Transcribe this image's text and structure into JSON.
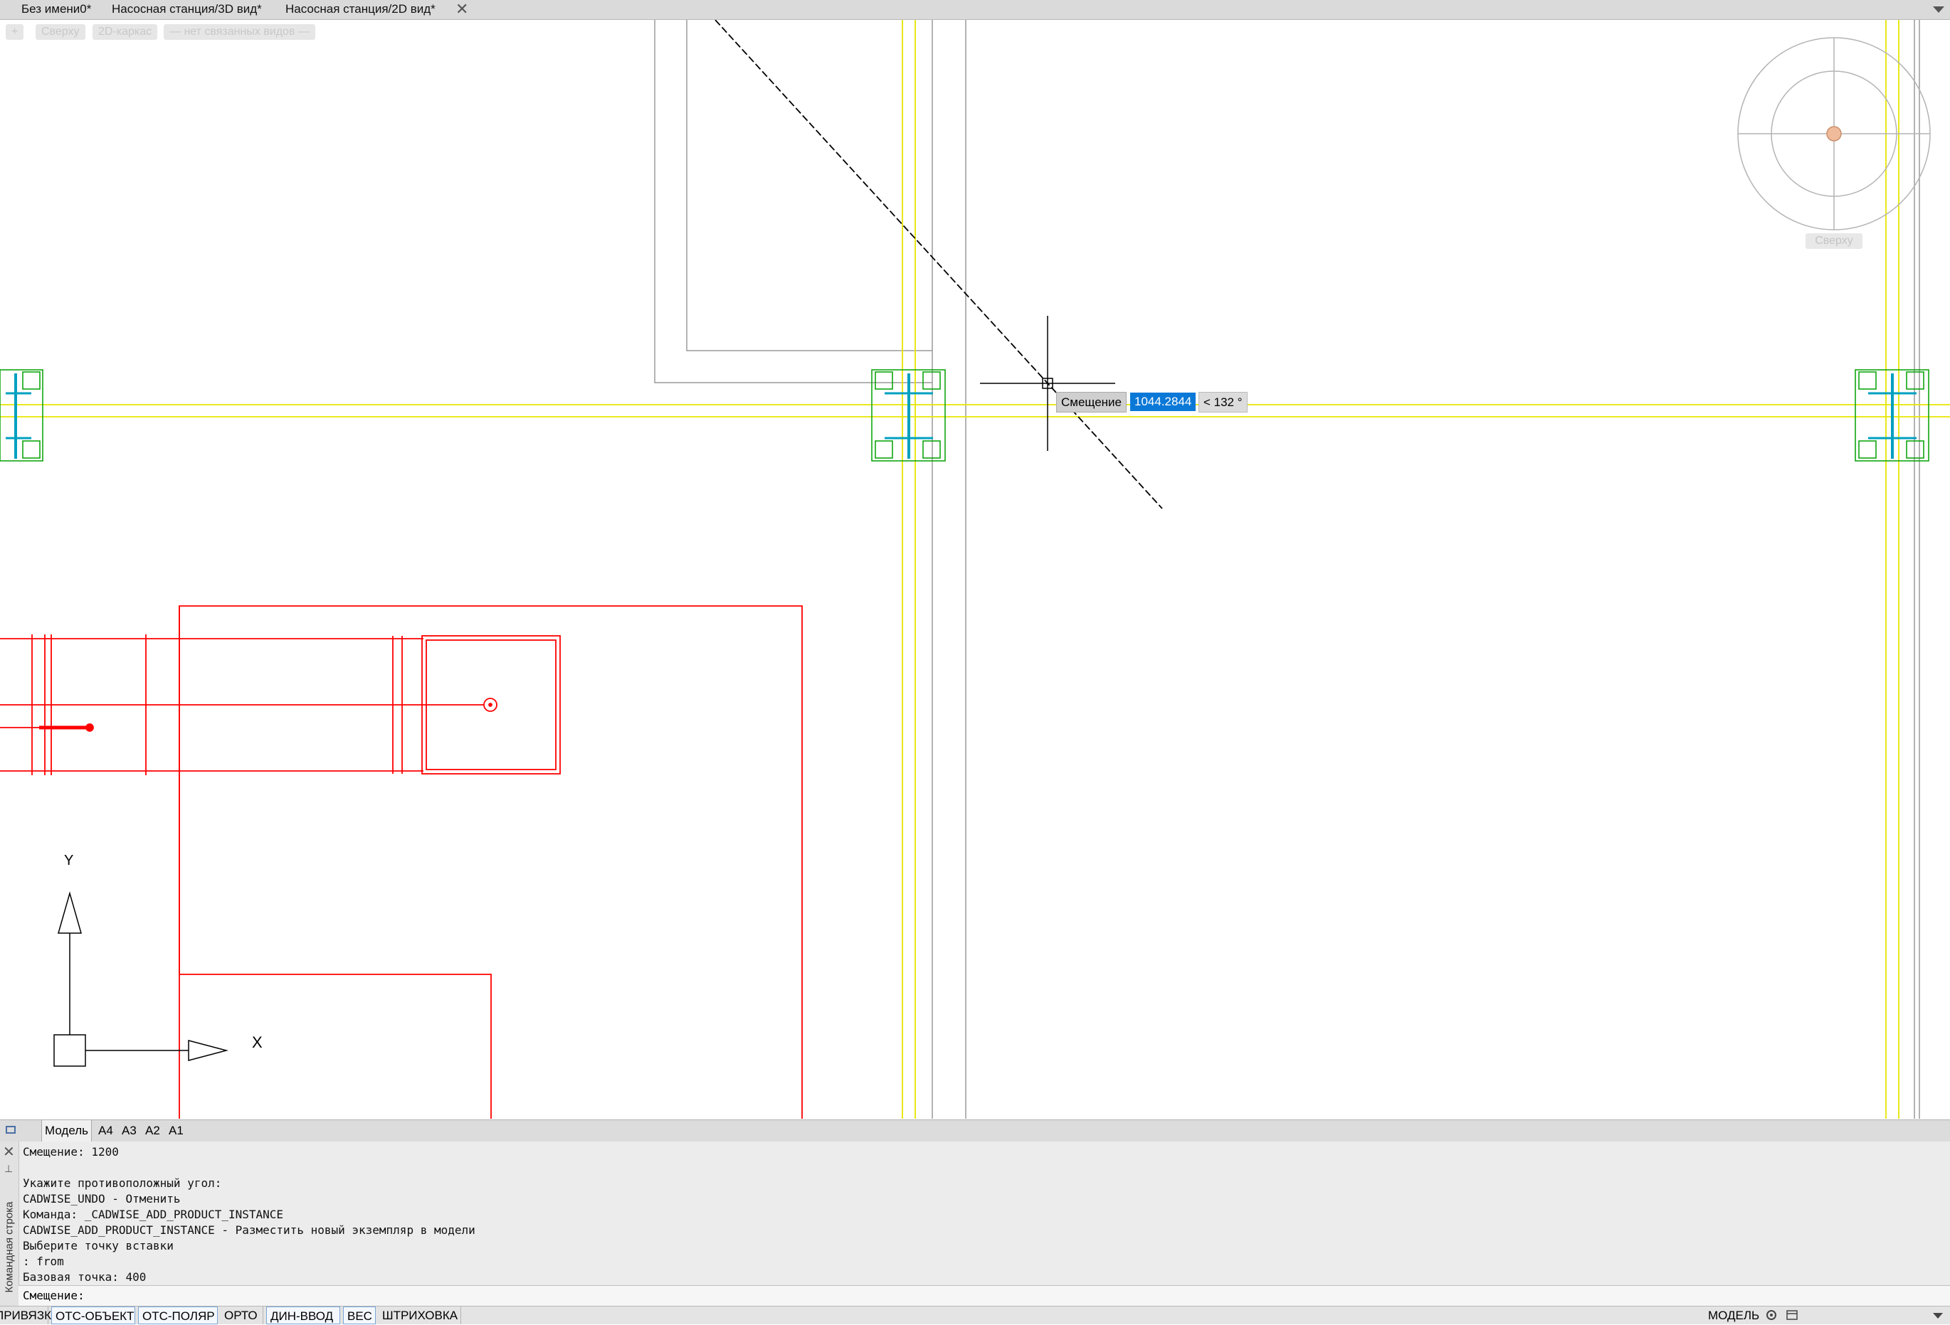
{
  "tabs": [
    {
      "label": "Без имени0*"
    },
    {
      "label": "Насосная станция/3D вид*"
    },
    {
      "label": "Насосная станция/2D вид*",
      "active": true
    }
  ],
  "tab_close": "✕",
  "view_controls": {
    "menu": "+",
    "view": "Сверху",
    "style": "2D-каркас",
    "linked": "— нет связанных видов —"
  },
  "viewcube": {
    "label": "Сверху"
  },
  "dynamic_input": {
    "label": "Смещение",
    "value": "1044.2844",
    "angle": "< 132 °"
  },
  "ucs": {
    "x_label": "X",
    "y_label": "Y"
  },
  "layout_tabs": [
    {
      "label": "Модель",
      "active": true
    },
    {
      "label": "A4"
    },
    {
      "label": "A3"
    },
    {
      "label": "A2"
    },
    {
      "label": "A1"
    }
  ],
  "command_line": {
    "side_label": "Командная строка",
    "history": [
      "Смещение: 1200",
      "",
      "Укажите противоположный угол:",
      "CADWISE_UNDO - Отменить",
      "Команда: _CADWISE_ADD_PRODUCT_INSTANCE",
      "CADWISE_ADD_PRODUCT_INSTANCE - Разместить новый экземпляр в модели",
      "Выберите точку вставки",
      ": from",
      "Базовая точка: 400"
    ],
    "prompt": "Смещение:",
    "input_value": ""
  },
  "status_bar": {
    "buttons": [
      {
        "label": "ПРИВЯЗКА",
        "on": false
      },
      {
        "label": "ОТС-ОБЪЕКТ",
        "on": true
      },
      {
        "label": "ОТС-ПОЛЯР",
        "on": true
      },
      {
        "label": "ОРТО",
        "on": false
      },
      {
        "label": "ДИН-ВВОД",
        "on": true
      },
      {
        "label": "ВЕС",
        "on": true
      },
      {
        "label": "ШТРИХОВКА",
        "on": false
      }
    ],
    "mode": "МОДЕЛЬ"
  },
  "colors": {
    "red_layer": "#ff0000",
    "yellow_layer": "#e6e600",
    "green_layer": "#00a000",
    "cyan_layer": "#00a0c0",
    "gray_layer": "#9a9a9a",
    "dyn_value_bg": "#0a78d7"
  }
}
